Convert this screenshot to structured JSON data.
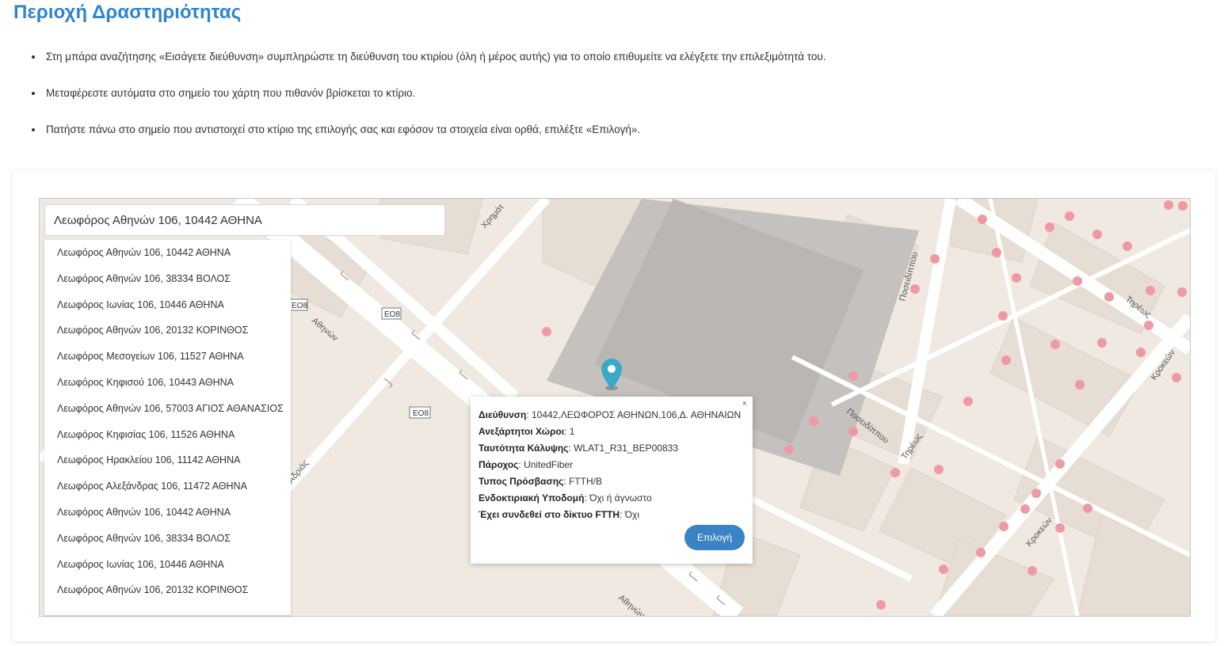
{
  "page": {
    "title": "Περιοχή Δραστηριότητας",
    "instructions": [
      "Στη μπάρα αναζήτησης «Εισάγετε διεύθυνση» συμπληρώστε τη διεύθυνση του κτιρίου (όλη ή μέρος αυτής) για το οποίο επιθυμείτε να ελέγξετε την επιλεξιμότητά του.",
      "Μεταφέρεστε αυτόματα στο σημείο του χάρτη που πιθανόν βρίσκεται το κτίριο.",
      "Πατήστε πάνω στο σημείο που αντιστοιχεί στο κτίριο της επιλογής σας και εφόσον τα στοιχεία είναι ορθά, επιλέξτε «Επιλογή»."
    ]
  },
  "search": {
    "value": "Λεωφόρος Αθηνών 106, 10442 ΑΘΗΝΑ",
    "suggestions": [
      "Λεωφόρος Αθηνών 106, 10442 ΑΘΗΝΑ",
      "Λεωφόρος Αθηνών 106, 38334 ΒΟΛΟΣ",
      "Λεωφόρος Ιωνίας 106, 10446 ΑΘΗΝΑ",
      "Λεωφόρος Αθηνών 106, 20132 ΚΟΡΙΝΘΟΣ",
      "Λεωφόρος Μεσογείων 106, 11527 ΑΘΗΝΑ",
      "Λεωφόρος Κηφισού 106, 10443 ΑΘΗΝΑ",
      "Λεωφόρος Αθηνών 106, 57003 ΑΓΙΟΣ ΑΘΑΝΑΣΙΟΣ",
      "Λεωφόρος Κηφισίας 106, 11526 ΑΘΗΝΑ",
      "Λεωφόρος Ηρακλείου 106, 11142 ΑΘΗΝΑ",
      "Λεωφόρος Αλεξάνδρας 106, 11472 ΑΘΗΝΑ",
      "Λεωφόρος Αθηνών 106, 10442 ΑΘΗΝΑ",
      "Λεωφόρος Αθηνών 106, 38334 ΒΟΛΟΣ",
      "Λεωφόρος Ιωνίας 106, 10446 ΑΘΗΝΑ",
      "Λεωφόρος Αθηνών 106, 20132 ΚΟΡΙΝΘΟΣ"
    ]
  },
  "map": {
    "road_labels": [
      "Χρημάτ",
      "Αθηνών",
      "Αδριάς",
      "Αθηνών",
      "Ποσειδίππου",
      "Ποσειδίππου",
      "Τηρέως",
      "Τηρέως",
      "Κροκεών",
      "Κροκεών"
    ],
    "route_shields": [
      "EO8",
      "EO8",
      "EO8"
    ],
    "colors": {
      "land": "#efe9e1",
      "road": "#ffffff",
      "block": "#e6ded4",
      "building_dark": "#b9b6b3",
      "marker": "#ef9aa3",
      "pin": "#39a9c7"
    }
  },
  "popup": {
    "close": "×",
    "rows": [
      {
        "label": "Διεύθυνση",
        "value": "10442,ΛΕΩΦΟΡΟΣ ΑΘΗΝΩΝ,106,Δ. ΑΘΗΝΑΙΩΝ"
      },
      {
        "label": "Ανεξάρτητοι Χώροι",
        "value": "1"
      },
      {
        "label": "Ταυτότητα Κάλυψης",
        "value": "WLAT1_R31_BEP00833"
      },
      {
        "label": "Πάροχος",
        "value": "UnitedFiber"
      },
      {
        "label": "Τυπος Πρόσβασης",
        "value": "FTTH/B"
      },
      {
        "label": "Ενδοκτιριακή Υποδομή",
        "value": "Όχι ή άγνωστο"
      },
      {
        "label": "Έχει συνδεθεί στο δίκτυο FTTH",
        "value": "Όχι"
      }
    ],
    "select_label": "Επιλογή"
  }
}
